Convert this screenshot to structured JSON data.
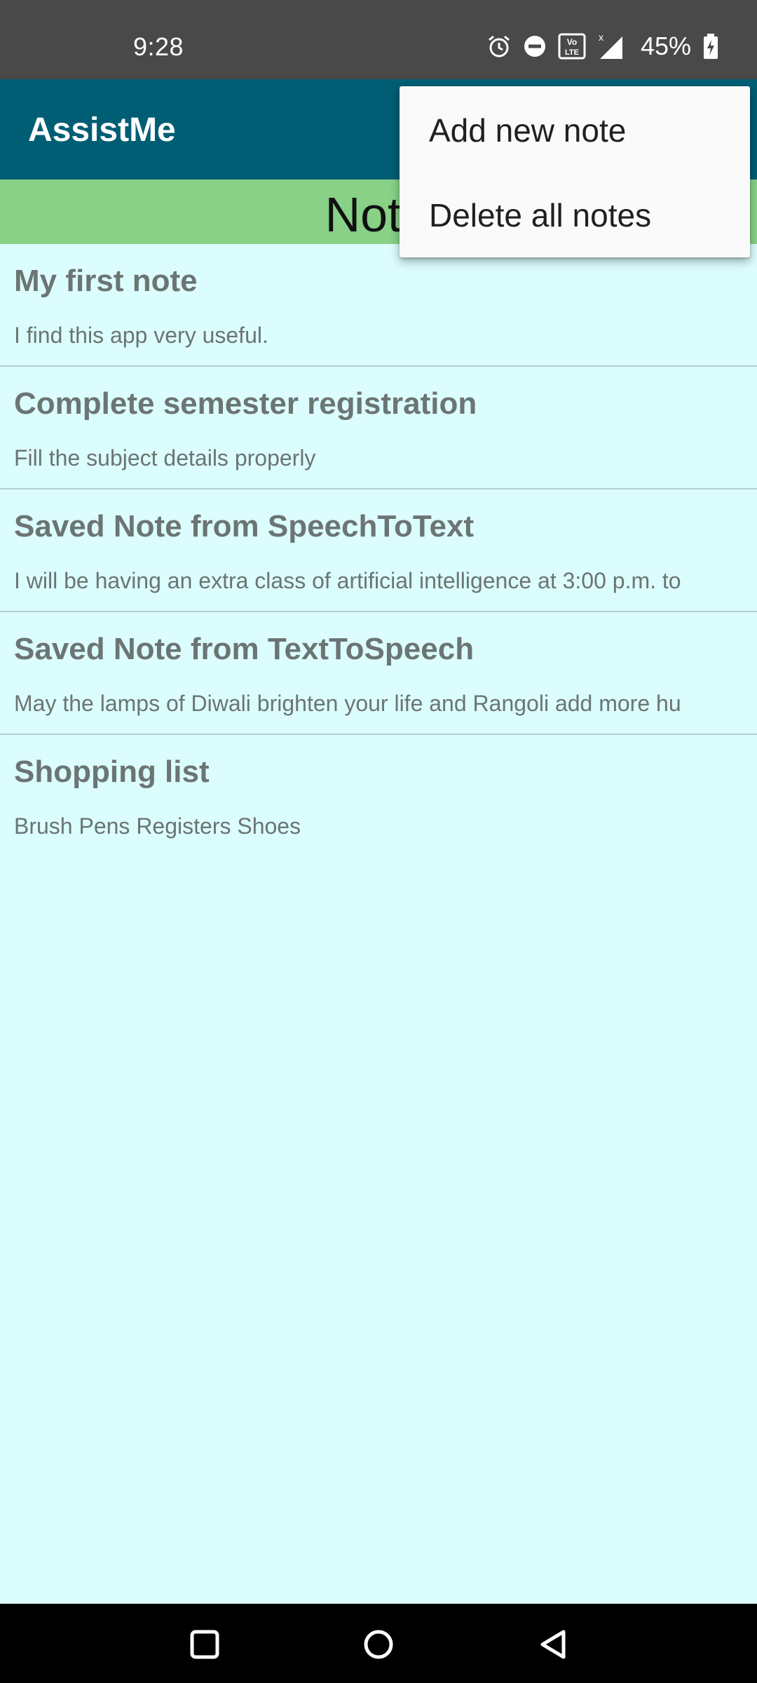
{
  "status_bar": {
    "time": "9:28",
    "battery": "45%",
    "icons": [
      "alarm-icon",
      "do-not-disturb-icon",
      "volte-icon",
      "signal-icon",
      "battery-charging-icon"
    ]
  },
  "app_bar": {
    "title": "AssistMe",
    "color": "#005e74"
  },
  "section_header": {
    "title": "Notes",
    "color": "#88d187"
  },
  "notes": [
    {
      "title": "My first note",
      "body": "I find this app very useful."
    },
    {
      "title": "Complete semester registration",
      "body": "Fill the subject details properly"
    },
    {
      "title": "Saved Note from SpeechToText",
      "body": "I will be having an extra class of artificial intelligence at 3:00 p.m. to"
    },
    {
      "title": "Saved Note from TextToSpeech",
      "body": "May the lamps of Diwali brighten your life and Rangoli add more hu"
    },
    {
      "title": "Shopping list",
      "body": "Brush Pens Registers Shoes"
    }
  ],
  "menu": {
    "items": [
      {
        "label": "Add new note"
      },
      {
        "label": "Delete all notes"
      }
    ]
  },
  "nav_bar": {
    "icons": [
      "recent-apps-icon",
      "home-icon",
      "back-icon"
    ]
  }
}
